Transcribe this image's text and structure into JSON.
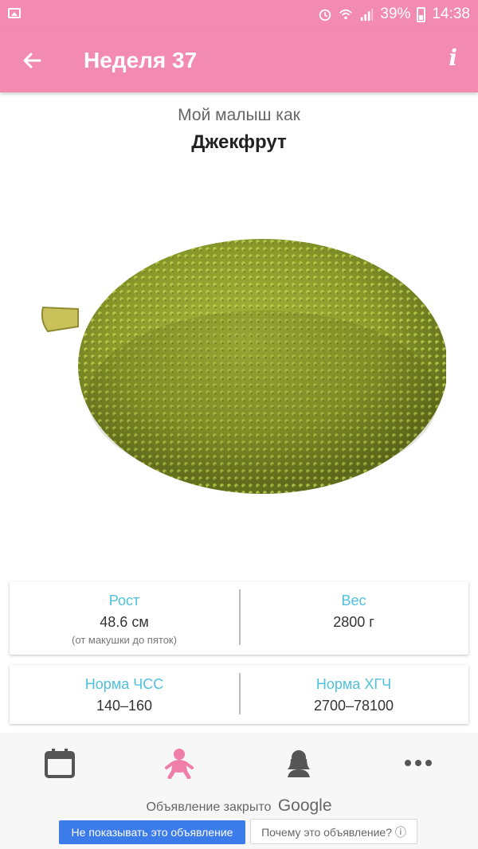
{
  "status_bar": {
    "battery": "39%",
    "time": "14:38"
  },
  "app_bar": {
    "title": "Неделя 37",
    "info_label": "i"
  },
  "header": {
    "subtitle": "Мой малыш как",
    "fruit_name": "Джекфрут"
  },
  "stats": {
    "height_label": "Рост",
    "height_value": "48.6 см",
    "height_note": "(от макушки до пяток)",
    "weight_label": "Вес",
    "weight_value": "2800 г",
    "hr_label": "Норма ЧСС",
    "hr_value": "140–160",
    "hcg_label": "Норма ХГЧ",
    "hcg_value": "2700–78100"
  },
  "bottom_nav": {
    "items": [
      "calendar-icon",
      "baby-icon",
      "mother-icon",
      "more-icon"
    ]
  },
  "ad": {
    "closed_text": "Объявление закрыто",
    "brand": "Google",
    "hide_button": "Не показывать это объявление",
    "why_button": "Почему это объявление? ⓘ"
  },
  "colors": {
    "primary": "#f38bb0",
    "accent": "#4fc1dc"
  }
}
